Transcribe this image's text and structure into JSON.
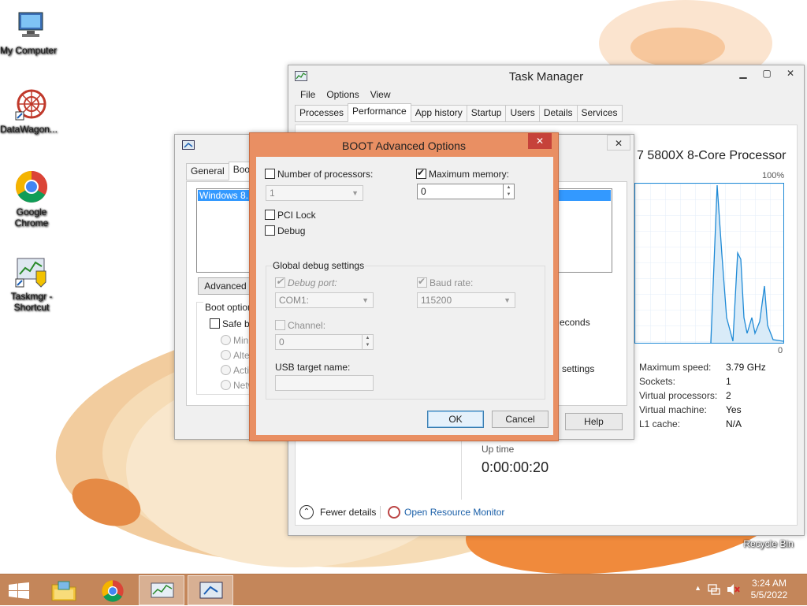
{
  "desktop": {
    "icons": [
      {
        "label": "My Computer",
        "icon": "computer-icon"
      },
      {
        "label": "DataWagon...",
        "icon": "datawagon-icon"
      },
      {
        "label": "Google Chrome",
        "icon": "chrome-icon"
      },
      {
        "label": "Taskmgr - Shortcut",
        "icon": "taskmgr-shortcut-icon"
      }
    ],
    "recycle_bin_label": "Recycle Bin"
  },
  "task_manager": {
    "title": "Task Manager",
    "menu": [
      "File",
      "Options",
      "View"
    ],
    "tabs": [
      "Processes",
      "Performance",
      "App history",
      "Startup",
      "Users",
      "Details",
      "Services"
    ],
    "active_tab": "Performance",
    "cpu_name": "7 5800X 8-Core Processor",
    "chart_max_label": "100%",
    "chart_min_label": "0",
    "specs": [
      {
        "key": "Maximum speed:",
        "value": "3.79 GHz"
      },
      {
        "key": "Sockets:",
        "value": "1"
      },
      {
        "key": "Virtual processors:",
        "value": "2"
      },
      {
        "key": "Virtual machine:",
        "value": "Yes"
      },
      {
        "key": "L1 cache:",
        "value": "N/A"
      }
    ],
    "uptime_label": "Up time",
    "uptime_value": "0:00:00:20",
    "fewer_details": "Fewer details",
    "open_resource_monitor": "Open Resource Monitor"
  },
  "msconfig": {
    "tabs": [
      "General",
      "Boot"
    ],
    "boot_entry": "Windows 8.1",
    "advanced_button": "Advanced o",
    "boot_options_label": "Boot options",
    "safe_boot_label": "Safe bo",
    "safe_boot_radios": [
      "Minin",
      "Alter",
      "Activ",
      "Netw"
    ],
    "timeout_partial": "econds",
    "settings_partial": "settings",
    "help_button": "Help"
  },
  "boot_advanced": {
    "title": "BOOT Advanced Options",
    "num_processors_label": "Number of processors:",
    "num_processors_checked": false,
    "num_processors_value": "1",
    "max_memory_label": "Maximum memory:",
    "max_memory_checked": true,
    "max_memory_value": "0",
    "pci_lock_label": "PCI Lock",
    "debug_label": "Debug",
    "global_debug_label": "Global debug settings",
    "debug_port_label": "Debug port:",
    "debug_port_value": "COM1:",
    "baud_rate_label": "Baud rate:",
    "baud_rate_value": "115200",
    "channel_label": "Channel:",
    "channel_value": "0",
    "usb_target_label": "USB target name:",
    "ok_button": "OK",
    "cancel_button": "Cancel"
  },
  "taskbar": {
    "time": "3:24 AM",
    "date": "5/5/2022",
    "accent": "#c4865a"
  }
}
